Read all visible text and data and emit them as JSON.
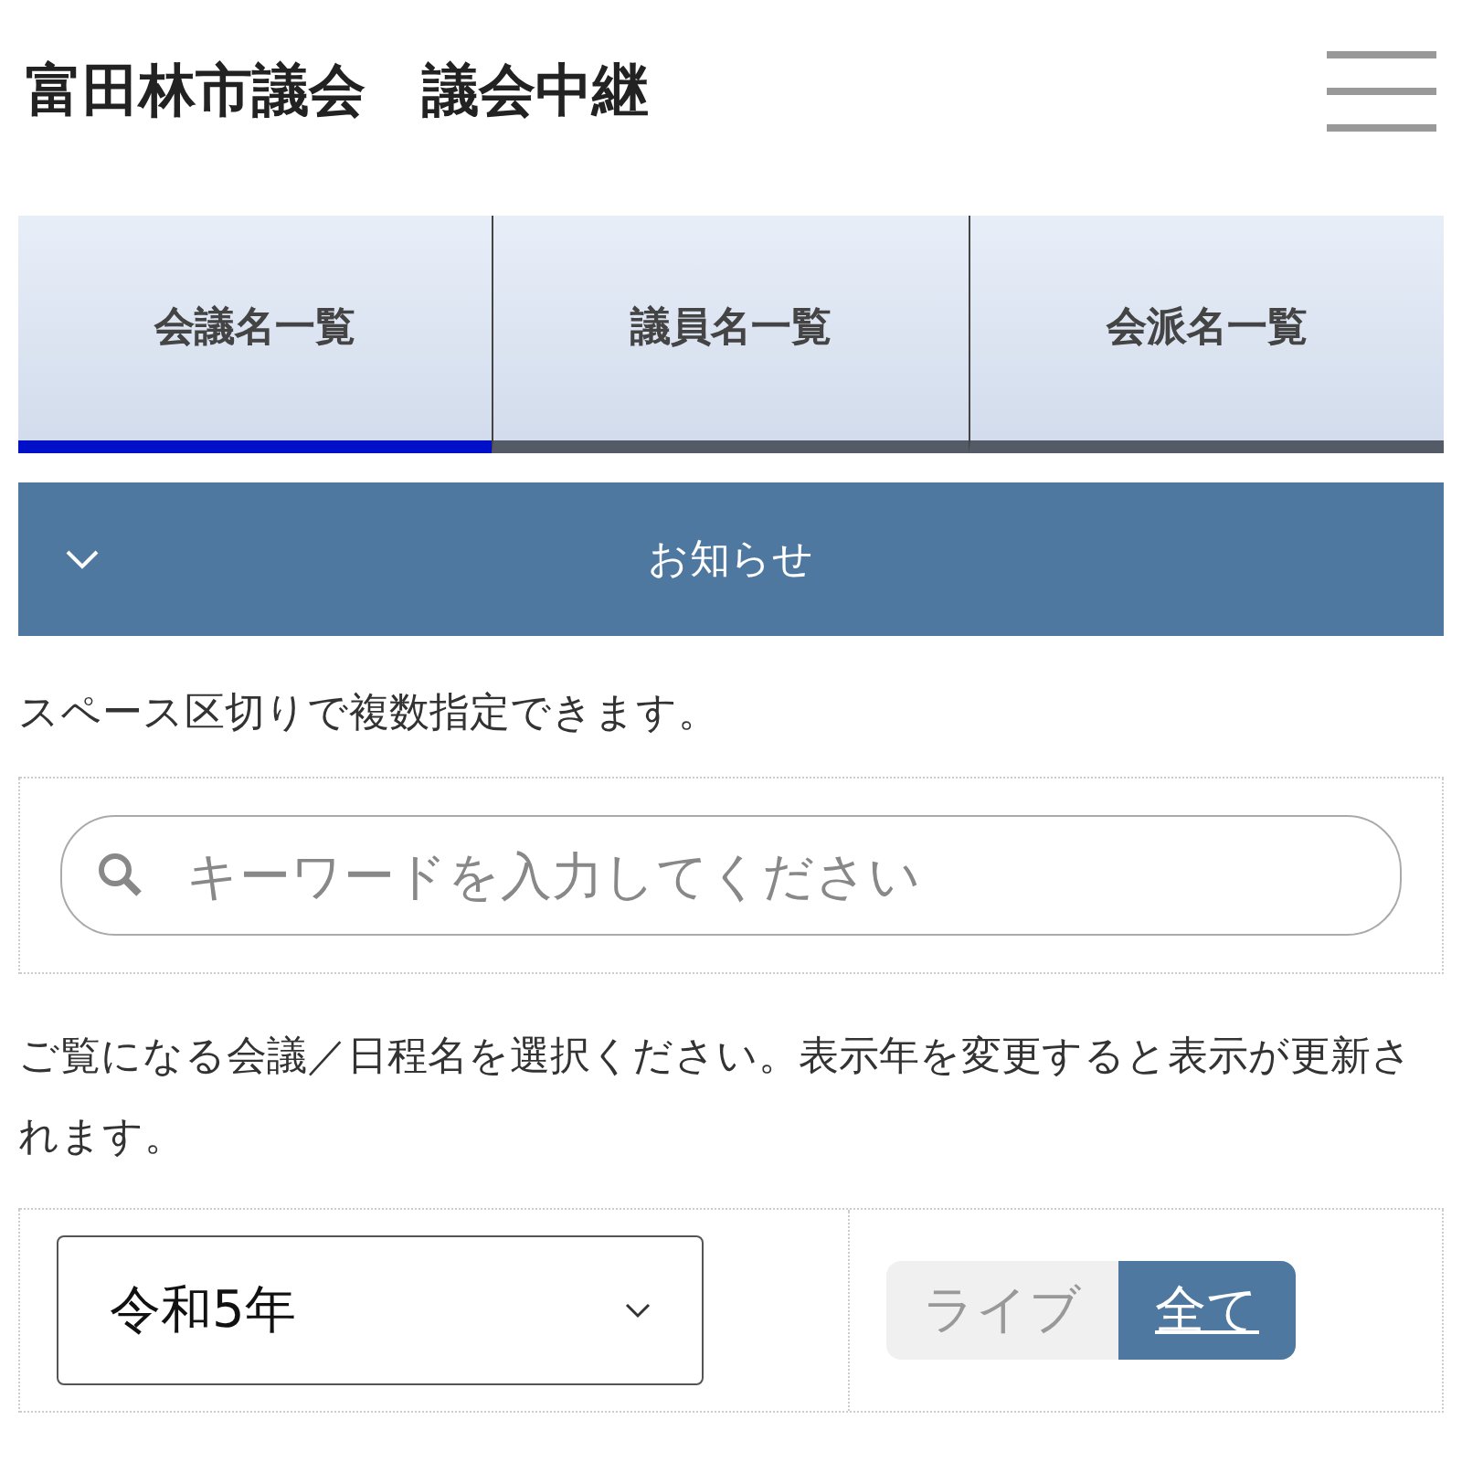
{
  "header": {
    "title": "富田林市議会　議会中継"
  },
  "tabs": [
    {
      "label": "会議名一覧",
      "selected": true
    },
    {
      "label": "議員名一覧",
      "selected": false
    },
    {
      "label": "会派名一覧",
      "selected": false
    }
  ],
  "notice": {
    "label": "お知らせ",
    "expanded": false
  },
  "search_hint": "スペース区切りで複数指定できます。",
  "search": {
    "placeholder": "キーワードを入力してください"
  },
  "select_hint": "ご覧になる会議／日程名を選択ください。表示年を変更すると表示が更新されます。",
  "year_select": {
    "value": "令和5年"
  },
  "filter": [
    {
      "label": "ライブ",
      "selected": false
    },
    {
      "label": "全て",
      "selected": true
    }
  ]
}
